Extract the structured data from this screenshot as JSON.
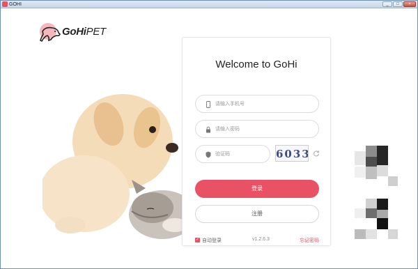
{
  "window": {
    "title": "GOHI",
    "controls": [
      "minimize",
      "maximize",
      "close"
    ]
  },
  "logo": {
    "bold": "GoHi",
    "light": "PET"
  },
  "login": {
    "title": "Welcome to GoHi",
    "phone_placeholder": "请输入手机号",
    "password_placeholder": "请输入密码",
    "captcha_placeholder": "验证码",
    "captcha_text": "6033",
    "login_button": "登录",
    "register_button": "注册",
    "auto_login_label": "自动登录",
    "auto_login_checked": true,
    "version": "v1.2.6.3",
    "forgot_password": "忘记密码"
  },
  "colors": {
    "accent": "#e95165",
    "logo_circle": "#f4b7bd"
  }
}
